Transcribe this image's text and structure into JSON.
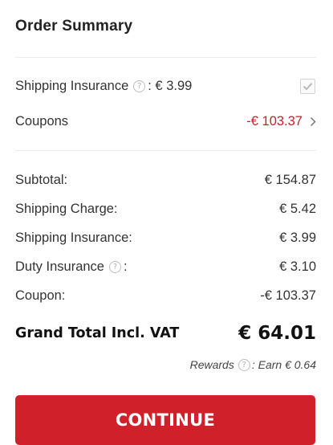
{
  "summary": {
    "title": "Order Summary"
  },
  "options": {
    "shipping_insurance": {
      "label": "Shipping Insurance",
      "price": ": € 3.99",
      "checked": true
    },
    "coupons": {
      "label": "Coupons",
      "value": "-€ 103.37"
    }
  },
  "totals": {
    "subtotal": {
      "label": "Subtotal:",
      "value": "€ 154.87"
    },
    "shipping_charge": {
      "label": "Shipping Charge:",
      "value": "€ 5.42"
    },
    "shipping_insurance": {
      "label": "Shipping Insurance:",
      "value": "€ 3.99"
    },
    "duty_insurance": {
      "label": "Duty Insurance",
      "suffix": ":",
      "value": "€ 3.10"
    },
    "coupon": {
      "label": "Coupon:",
      "value": "-€ 103.37"
    }
  },
  "grand_total": {
    "label": "Grand Total Incl. VAT",
    "value": "€ 64.01"
  },
  "rewards": {
    "label": "Rewards",
    "earn": ": Earn € 0.64"
  },
  "cta": {
    "label": "CONTINUE"
  },
  "icons": {
    "help": "question-mark-circle-icon",
    "check": "checkmark-icon",
    "chevron": "chevron-right-icon"
  },
  "colors": {
    "accent": "#d0202a",
    "coupon_text": "#c8202b"
  }
}
